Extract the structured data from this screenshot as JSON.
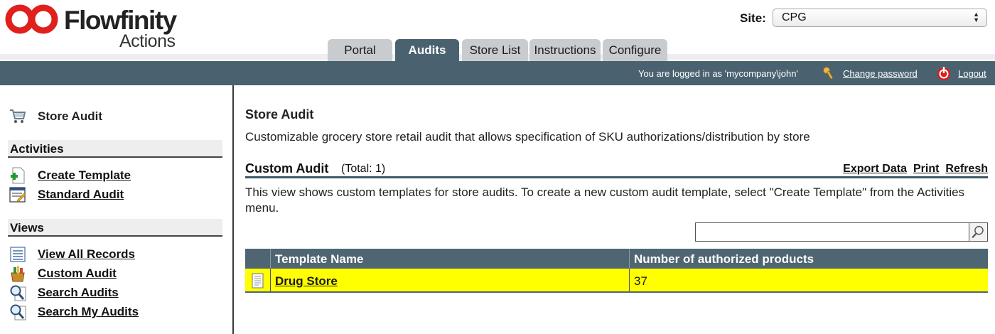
{
  "brand": {
    "name": "Flowfinity",
    "product": "Actions"
  },
  "site": {
    "label": "Site:",
    "selected": "CPG"
  },
  "tabs": [
    {
      "label": "Portal",
      "active": false
    },
    {
      "label": "Audits",
      "active": true
    },
    {
      "label": "Store List",
      "active": false
    },
    {
      "label": "Instructions",
      "active": false
    },
    {
      "label": "Configure",
      "active": false
    }
  ],
  "userbar": {
    "login_text": "You are logged in as 'mycompany\\john'",
    "change_password": "Change password",
    "logout": "Logout"
  },
  "sidebar": {
    "title": "Store Audit",
    "sections": [
      {
        "heading": "Activities",
        "items": [
          {
            "label": "Create Template",
            "icon": "create-template-icon"
          },
          {
            "label": "Standard Audit",
            "icon": "standard-audit-icon"
          }
        ]
      },
      {
        "heading": "Views",
        "items": [
          {
            "label": "View All Records",
            "icon": "list-icon"
          },
          {
            "label": "Custom Audit",
            "icon": "custom-audit-icon"
          },
          {
            "label": "Search Audits",
            "icon": "search-icon"
          },
          {
            "label": "Search My Audits",
            "icon": "search-icon"
          }
        ]
      }
    ]
  },
  "main": {
    "title": "Store Audit",
    "description": "Customizable grocery store retail audit that allows specification of SKU authorizations/distribution by store",
    "view": {
      "title": "Custom Audit",
      "total": "(Total: 1)",
      "actions": [
        "Export Data",
        "Print",
        "Refresh"
      ],
      "note": "This view shows custom templates for store audits. To create a new custom audit template, select \"Create Template\" from the Activities menu.",
      "search_value": ""
    },
    "table": {
      "columns": [
        "Template Name",
        "Number of authorized products"
      ],
      "rows": [
        {
          "name": "Drug Store",
          "count": "37",
          "highlight": "#ffff00"
        }
      ]
    }
  },
  "colors": {
    "header_bar": "#4a6270",
    "highlight_row": "#ffff00",
    "logo_red": "#e0201c"
  }
}
